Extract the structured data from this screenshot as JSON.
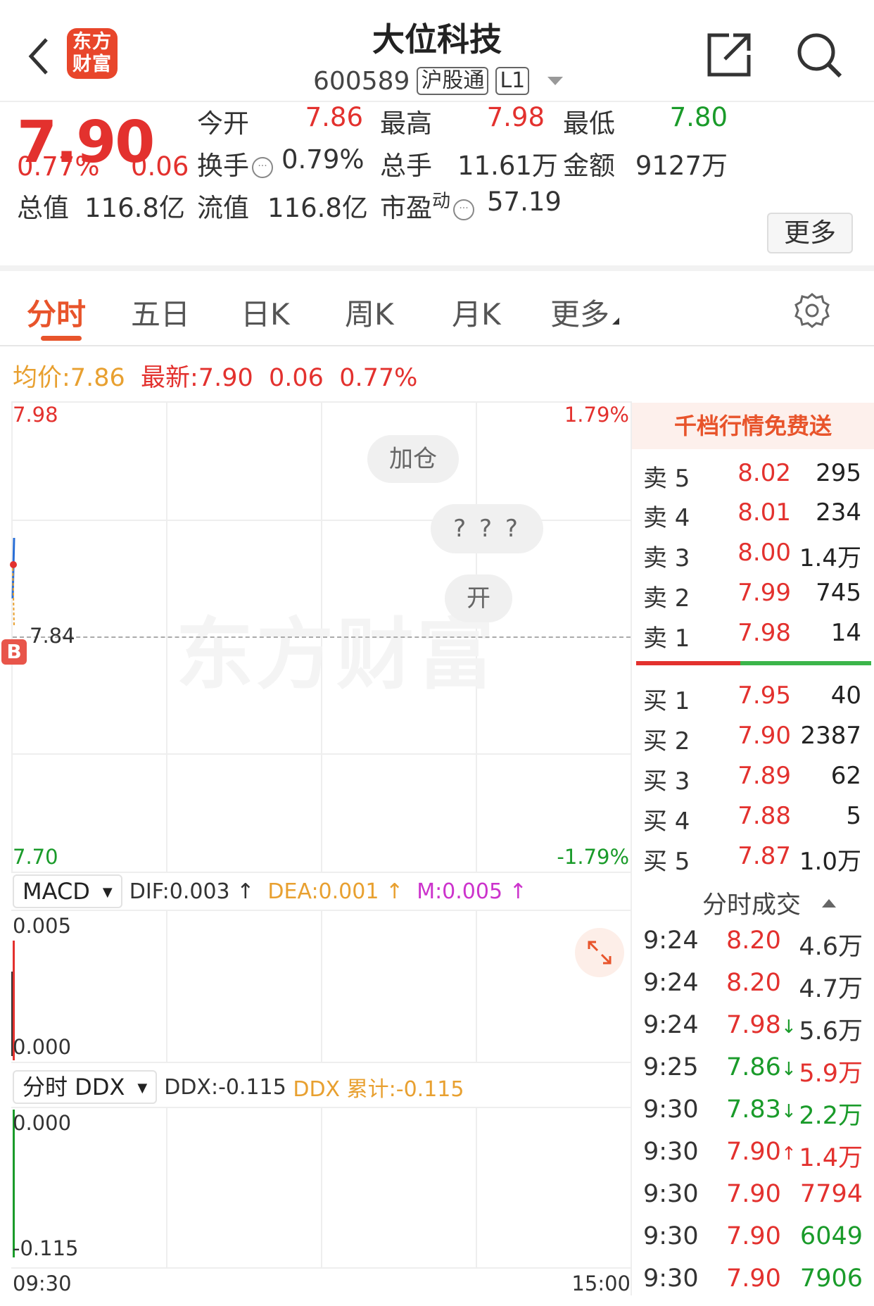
{
  "header": {
    "logo_line1": "东方",
    "logo_line2": "财富",
    "stock_name": "大位科技",
    "stock_code": "600589",
    "tag_connect": "沪股通",
    "tag_level": "L1"
  },
  "quote": {
    "price": "7.90",
    "change_pct": "0.77%",
    "change": "0.06",
    "open_label": "今开",
    "open": "7.86",
    "high_label": "最高",
    "high": "7.98",
    "low_label": "最低",
    "low": "7.80",
    "turnover_label": "换手",
    "turnover": "0.79%",
    "volume_label": "总手",
    "volume": "11.61万",
    "amount_label": "金额",
    "amount": "9127万",
    "mktcap_label": "总值",
    "mktcap": "116.8亿",
    "float_label": "流值",
    "float_cap": "116.8亿",
    "pe_label": "市盈",
    "pe_sup": "动",
    "pe": "57.19",
    "more_label": "更多"
  },
  "tabs": [
    "分时",
    "五日",
    "日K",
    "周K",
    "月K",
    "更多"
  ],
  "avg": {
    "avg_label": "均价:",
    "avg_value": "7.86",
    "latest_label": "最新:",
    "latest_value": "7.90",
    "change": "0.06",
    "change_pct": "0.77%"
  },
  "chart": {
    "y_high": "7.98",
    "y_mid": "7.84",
    "y_low": "7.70",
    "pct_high": "1.79%",
    "pct_low": "-1.79%",
    "pill1": "加仓",
    "pill2": "? ? ?",
    "pill3": "开",
    "b_marker": "B",
    "watermark": "东方财富",
    "x_start": "09:30",
    "x_end": "15:00"
  },
  "macd": {
    "selector": "MACD",
    "dif": "DIF:0.003 ↑",
    "dea": "DEA:0.001 ↑",
    "m": "M:0.005 ↑",
    "y_top": "0.005",
    "y_bottom": "0.000"
  },
  "ddx": {
    "selector": "分时 DDX",
    "ddx": "DDX:-0.115",
    "ddx_cum": "DDX 累计:-0.115",
    "y_top": "0.000",
    "y_bottom": "-0.115"
  },
  "orderbook": {
    "promo": "千档行情免费送",
    "asks": [
      {
        "label": "卖 5",
        "price": "8.02",
        "vol": "295"
      },
      {
        "label": "卖 4",
        "price": "8.01",
        "vol": "234"
      },
      {
        "label": "卖 3",
        "price": "8.00",
        "vol": "1.4万"
      },
      {
        "label": "卖 2",
        "price": "7.99",
        "vol": "745"
      },
      {
        "label": "卖 1",
        "price": "7.98",
        "vol": "14"
      }
    ],
    "bids": [
      {
        "label": "买 1",
        "price": "7.95",
        "vol": "40"
      },
      {
        "label": "买 2",
        "price": "7.90",
        "vol": "2387"
      },
      {
        "label": "买 3",
        "price": "7.89",
        "vol": "62"
      },
      {
        "label": "买 4",
        "price": "7.88",
        "vol": "5"
      },
      {
        "label": "买 5",
        "price": "7.87",
        "vol": "1.0万"
      }
    ]
  },
  "trades": {
    "title": "分时成交",
    "rows": [
      {
        "time": "9:24",
        "price": "8.20",
        "arrow": "",
        "vol": "4.6万"
      },
      {
        "time": "9:24",
        "price": "8.20",
        "arrow": "",
        "vol": "4.7万"
      },
      {
        "time": "9:24",
        "price": "7.98",
        "arrow": "↓",
        "vol": "5.6万"
      },
      {
        "time": "9:25",
        "price": "7.86",
        "arrow": "↓",
        "vol": "5.9万"
      },
      {
        "time": "9:30",
        "price": "7.83",
        "arrow": "↓",
        "vol": "2.2万"
      },
      {
        "time": "9:30",
        "price": "7.90",
        "arrow": "↑",
        "vol": "1.4万"
      },
      {
        "time": "9:30",
        "price": "7.90",
        "arrow": "",
        "vol": "7794"
      },
      {
        "time": "9:30",
        "price": "7.90",
        "arrow": "",
        "vol": "6049"
      },
      {
        "time": "9:30",
        "price": "7.90",
        "arrow": "",
        "vol": "7906"
      }
    ]
  },
  "colors": {
    "up": "#e3312e",
    "down": "#1a9b2a",
    "accent": "#e8542b",
    "avg": "#e8a030",
    "magenta": "#cc33cc"
  }
}
